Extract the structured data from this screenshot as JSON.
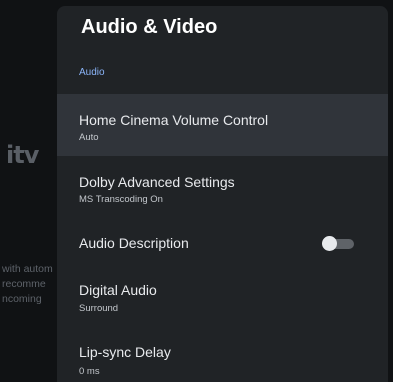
{
  "background": {
    "logo": "itv",
    "lines": [
      "with autom",
      "recomme",
      "ncoming"
    ]
  },
  "panel": {
    "title": "Audio & Video",
    "section": "Audio",
    "items": [
      {
        "title": "Home Cinema Volume Control",
        "subtitle": "Auto"
      },
      {
        "title": "Dolby Advanced Settings",
        "subtitle": "MS Transcoding On"
      },
      {
        "title": "Audio Description",
        "toggle": "off"
      },
      {
        "title": "Digital Audio",
        "subtitle": "Surround"
      },
      {
        "title": "Lip-sync Delay",
        "subtitle": "0 ms"
      }
    ]
  }
}
